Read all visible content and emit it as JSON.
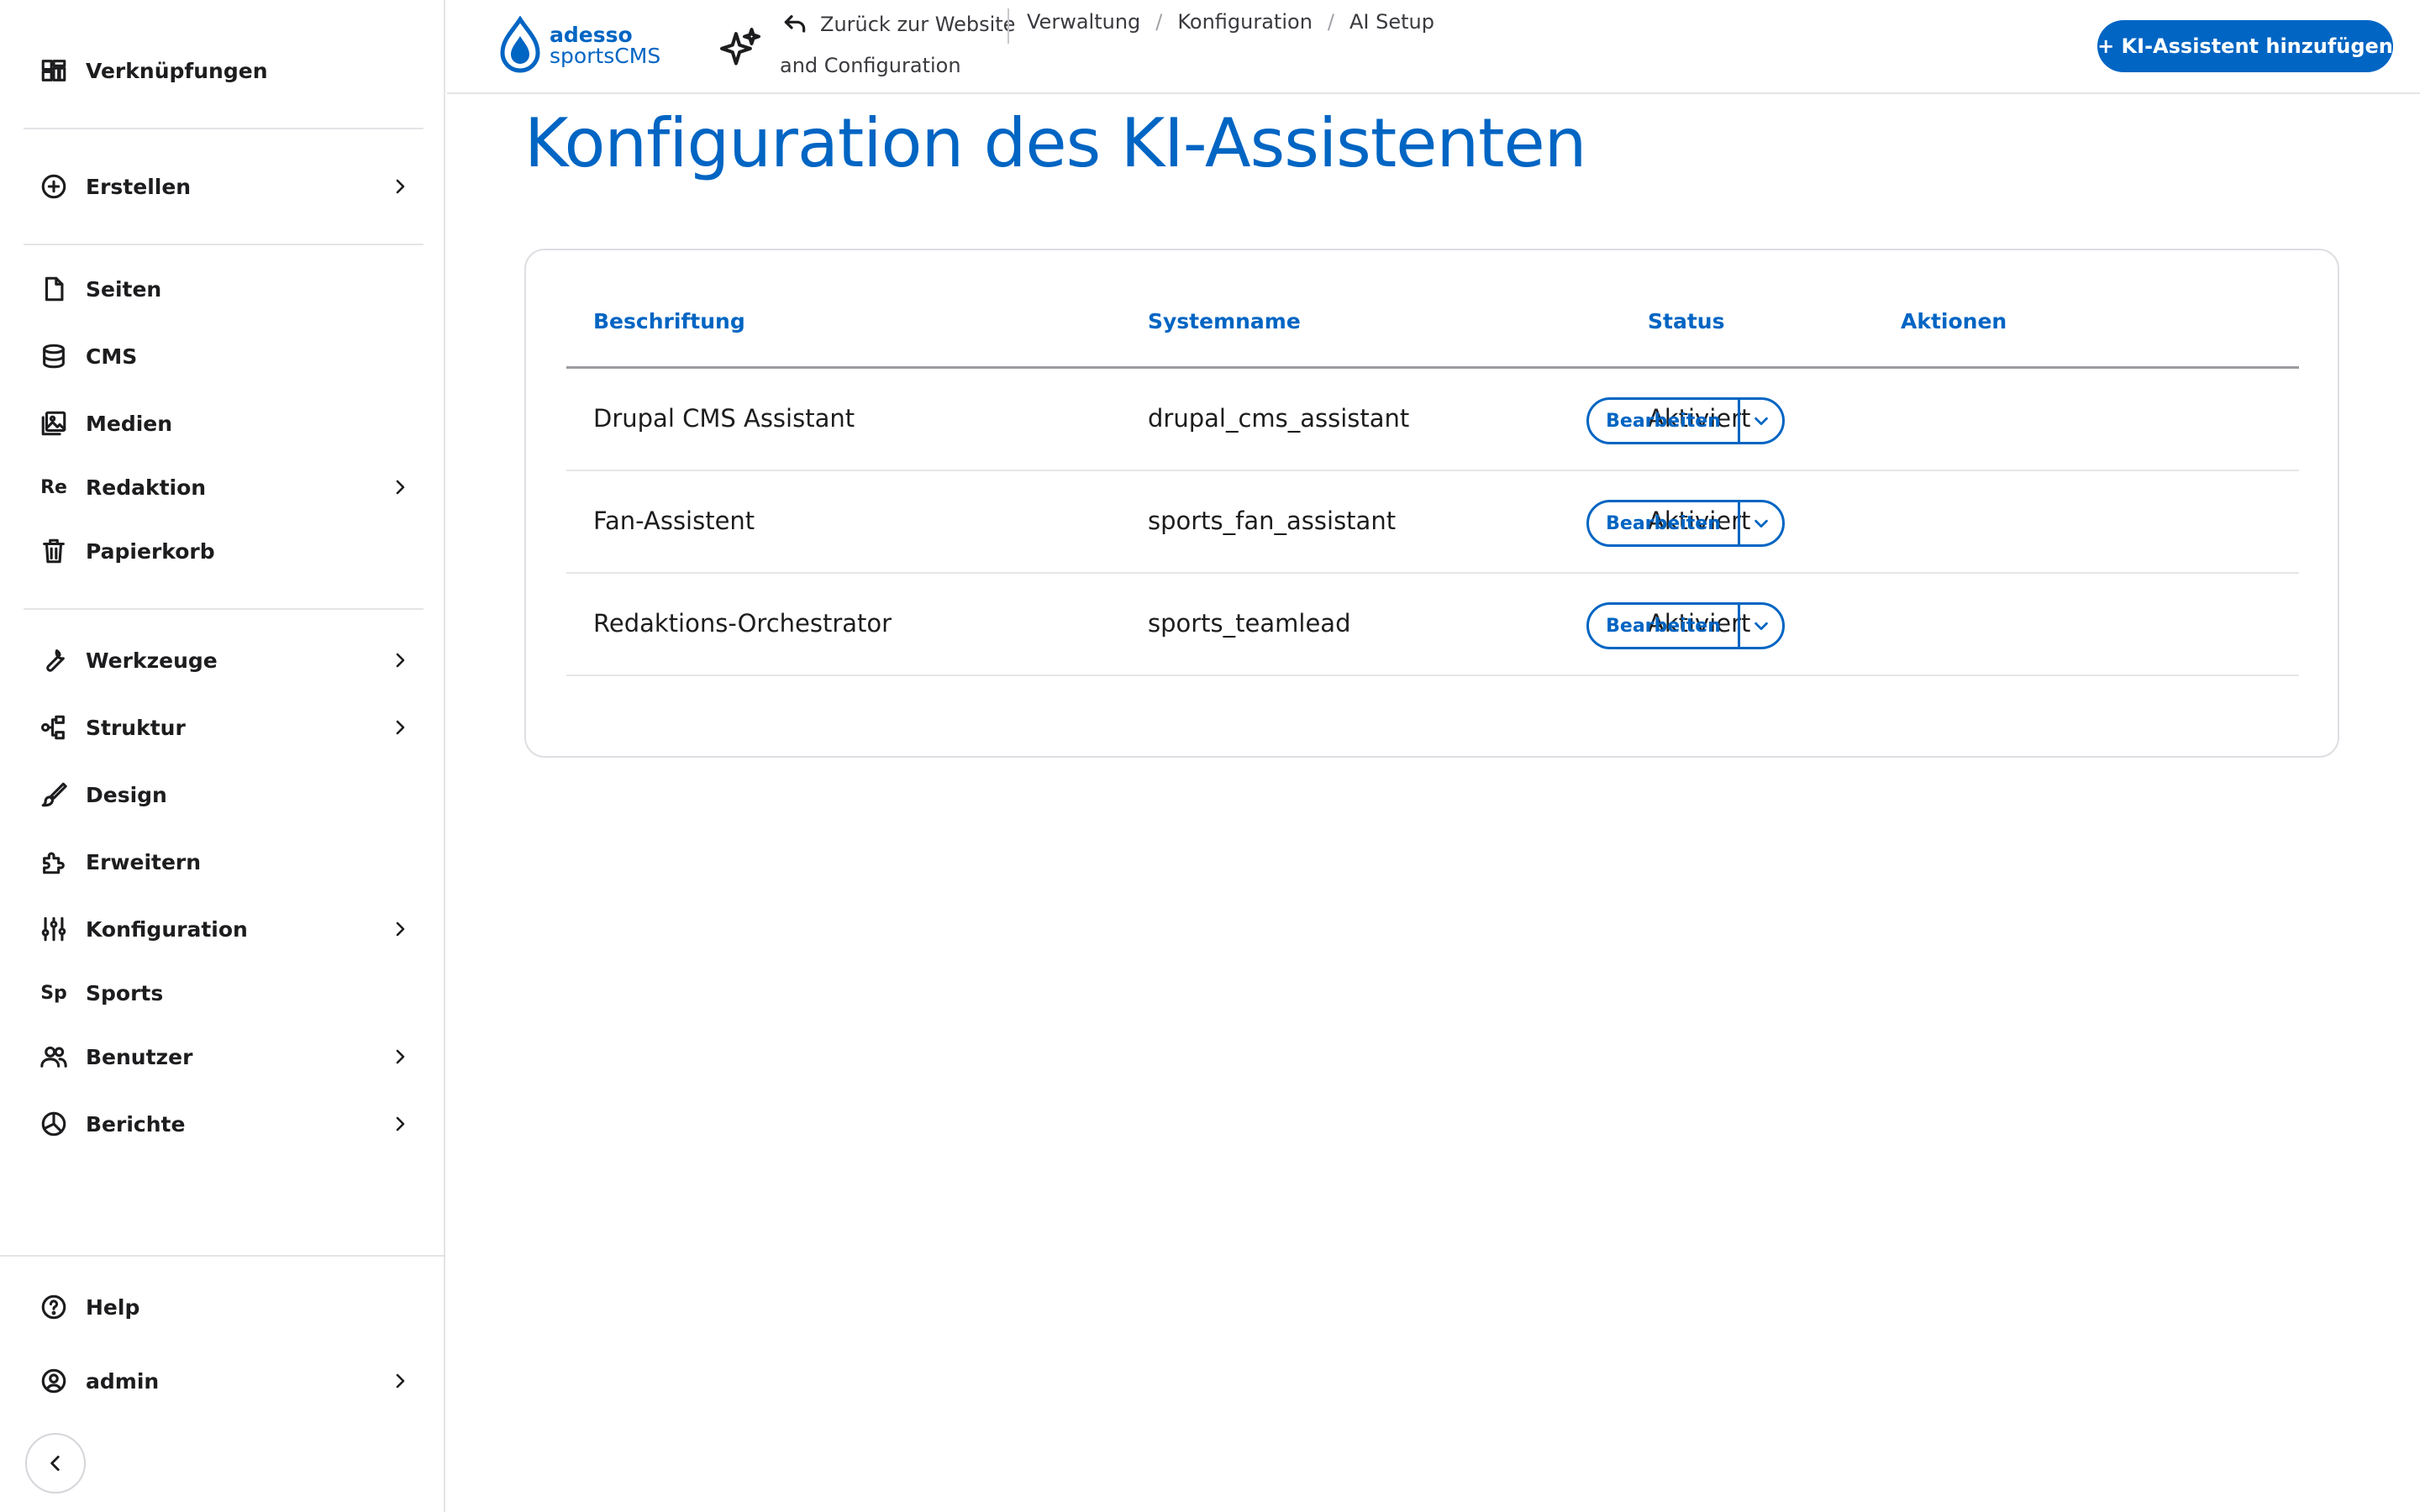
{
  "sidebar": {
    "items": [
      {
        "label": "Verknüpfungen",
        "icon": "shortcuts-grid-icon",
        "chevron": false
      },
      {
        "label": "Erstellen",
        "icon": "plus-circle-icon",
        "chevron": true
      },
      {
        "label": "Seiten",
        "icon": "page-icon",
        "chevron": false
      },
      {
        "label": "CMS",
        "icon": "database-icon",
        "chevron": false
      },
      {
        "label": "Medien",
        "icon": "media-icon",
        "chevron": false
      },
      {
        "label": "Redaktion",
        "abbr": "Re",
        "chevron": true
      },
      {
        "label": "Papierkorb",
        "icon": "trash-icon",
        "chevron": false
      },
      {
        "label": "Werkzeuge",
        "icon": "wrench-icon",
        "chevron": true
      },
      {
        "label": "Struktur",
        "icon": "structure-icon",
        "chevron": true
      },
      {
        "label": "Design",
        "icon": "brush-icon",
        "chevron": false
      },
      {
        "label": "Erweitern",
        "icon": "puzzle-icon",
        "chevron": false
      },
      {
        "label": "Konfiguration",
        "icon": "sliders-icon",
        "chevron": true
      },
      {
        "label": "Sports",
        "abbr": "Sp",
        "chevron": false
      },
      {
        "label": "Benutzer",
        "icon": "users-icon",
        "chevron": true
      },
      {
        "label": "Berichte",
        "icon": "pie-chart-icon",
        "chevron": true
      },
      {
        "label": "Help",
        "icon": "help-icon",
        "chevron": false
      },
      {
        "label": "admin",
        "icon": "user-circle-icon",
        "chevron": true
      }
    ]
  },
  "header": {
    "logo_line1": "adesso",
    "logo_line2": "sportsCMS",
    "back_label": "Zurück zur Website",
    "breadcrumb": [
      "Verwaltung",
      "Konfiguration",
      "AI Setup"
    ],
    "breadcrumb_cont": "and Configuration",
    "add_button": "+ KI-Assistent hinzufügen"
  },
  "main": {
    "title": "Konfiguration des KI-Assistenten",
    "table": {
      "columns": [
        "Beschriftung",
        "Systemname",
        "Status",
        "Aktionen"
      ],
      "rows": [
        {
          "label": "Drupal CMS Assistant",
          "machine_name": "drupal_cms_assistant",
          "status": "Aktiviert",
          "action": "Bearbeiten"
        },
        {
          "label": "Fan-Assistent",
          "machine_name": "sports_fan_assistant",
          "status": "Aktiviert",
          "action": "Bearbeiten"
        },
        {
          "label": "Redaktions-Orchestrator",
          "machine_name": "sports_teamlead",
          "status": "Aktiviert",
          "action": "Bearbeiten"
        }
      ]
    }
  },
  "colors": {
    "brand": "#0065c3",
    "text": "#1d1d1f",
    "border": "#e4e4e8"
  }
}
